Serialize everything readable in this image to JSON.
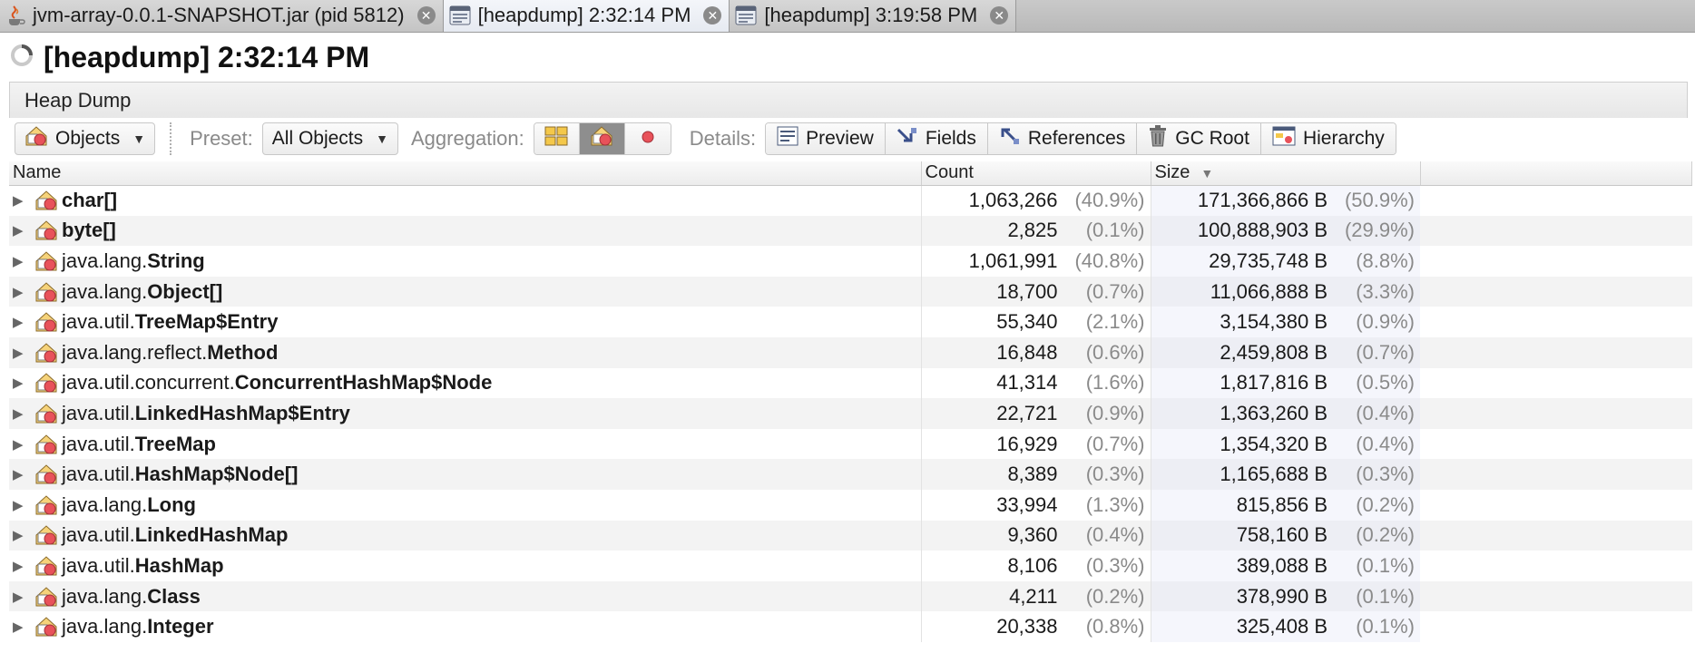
{
  "tabs": [
    {
      "label": "jvm-array-0.0.1-SNAPSHOT.jar (pid 5812)",
      "icon": "java-icon"
    },
    {
      "label": "[heapdump] 2:32:14 PM",
      "icon": "heapdump-icon"
    },
    {
      "label": "[heapdump] 3:19:58 PM",
      "icon": "heapdump-icon"
    }
  ],
  "title": "[heapdump] 2:32:14 PM",
  "section": "Heap Dump",
  "toolbar": {
    "view_select": "Objects",
    "preset_label": "Preset:",
    "preset_value": "All Objects",
    "aggregation_label": "Aggregation:",
    "details_label": "Details:",
    "details_buttons": [
      "Preview",
      "Fields",
      "References",
      "GC Root",
      "Hierarchy"
    ]
  },
  "table": {
    "columns": [
      "Name",
      "Count",
      "Size"
    ],
    "rows": [
      {
        "pkg": "",
        "cls": "char[]",
        "count": "1,063,266",
        "count_pct": "(40.9%)",
        "size": "171,366,866 B",
        "size_pct": "(50.9%)"
      },
      {
        "pkg": "",
        "cls": "byte[]",
        "count": "2,825",
        "count_pct": "(0.1%)",
        "size": "100,888,903 B",
        "size_pct": "(29.9%)"
      },
      {
        "pkg": "java.lang.",
        "cls": "String",
        "count": "1,061,991",
        "count_pct": "(40.8%)",
        "size": "29,735,748 B",
        "size_pct": "(8.8%)"
      },
      {
        "pkg": "java.lang.",
        "cls": "Object[]",
        "count": "18,700",
        "count_pct": "(0.7%)",
        "size": "11,066,888 B",
        "size_pct": "(3.3%)"
      },
      {
        "pkg": "java.util.",
        "cls": "TreeMap$Entry",
        "count": "55,340",
        "count_pct": "(2.1%)",
        "size": "3,154,380 B",
        "size_pct": "(0.9%)"
      },
      {
        "pkg": "java.lang.reflect.",
        "cls": "Method",
        "count": "16,848",
        "count_pct": "(0.6%)",
        "size": "2,459,808 B",
        "size_pct": "(0.7%)"
      },
      {
        "pkg": "java.util.concurrent.",
        "cls": "ConcurrentHashMap$Node",
        "count": "41,314",
        "count_pct": "(1.6%)",
        "size": "1,817,816 B",
        "size_pct": "(0.5%)"
      },
      {
        "pkg": "java.util.",
        "cls": "LinkedHashMap$Entry",
        "count": "22,721",
        "count_pct": "(0.9%)",
        "size": "1,363,260 B",
        "size_pct": "(0.4%)"
      },
      {
        "pkg": "java.util.",
        "cls": "TreeMap",
        "count": "16,929",
        "count_pct": "(0.7%)",
        "size": "1,354,320 B",
        "size_pct": "(0.4%)"
      },
      {
        "pkg": "java.util.",
        "cls": "HashMap$Node[]",
        "count": "8,389",
        "count_pct": "(0.3%)",
        "size": "1,165,688 B",
        "size_pct": "(0.3%)"
      },
      {
        "pkg": "java.lang.",
        "cls": "Long",
        "count": "33,994",
        "count_pct": "(1.3%)",
        "size": "815,856 B",
        "size_pct": "(0.2%)"
      },
      {
        "pkg": "java.util.",
        "cls": "LinkedHashMap",
        "count": "9,360",
        "count_pct": "(0.4%)",
        "size": "758,160 B",
        "size_pct": "(0.2%)"
      },
      {
        "pkg": "java.util.",
        "cls": "HashMap",
        "count": "8,106",
        "count_pct": "(0.3%)",
        "size": "389,088 B",
        "size_pct": "(0.1%)"
      },
      {
        "pkg": "java.lang.",
        "cls": "Class",
        "count": "4,211",
        "count_pct": "(0.2%)",
        "size": "378,990 B",
        "size_pct": "(0.1%)"
      },
      {
        "pkg": "java.lang.",
        "cls": "Integer",
        "count": "20,338",
        "count_pct": "(0.8%)",
        "size": "325,408 B",
        "size_pct": "(0.1%)"
      }
    ]
  }
}
